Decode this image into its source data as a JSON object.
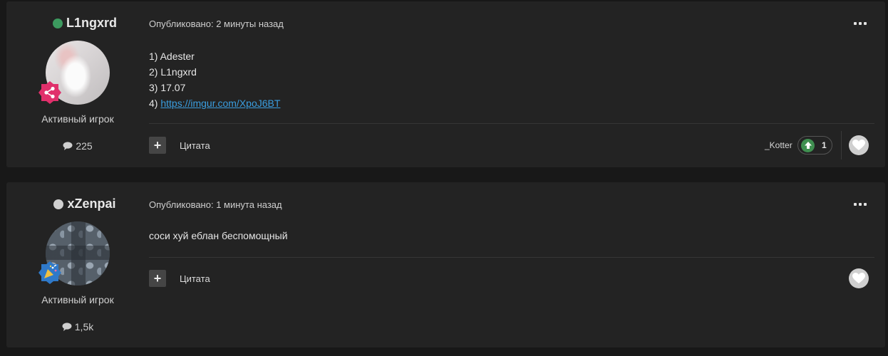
{
  "posts": [
    {
      "author": "L1ngxrd",
      "status_color": "#3c9a5f",
      "badge_color": "#e0306b",
      "badge_icon": "share-icon",
      "rank": "Активный игрок",
      "post_count": "225",
      "published": "Опубликовано: 2 минуты назад",
      "content_lines": [
        "1) Adester",
        "2) L1ngxrd",
        "3) 17.07"
      ],
      "content_link_prefix": "4) ",
      "content_link": "https://imgur.com/XpoJ6BT",
      "quote_label": "Цитата",
      "reaction": {
        "user": "_Kotter",
        "count": "1",
        "icon": "upvote-icon",
        "color": "#3f8f50"
      }
    },
    {
      "author": "xZenpai",
      "status_color": "#d0d0d0",
      "badge_color": "#2f79c9",
      "badge_icon": "party-popper-icon",
      "rank": "Активный игрок",
      "post_count": "1,5k",
      "published": "Опубликовано: 1 минута назад",
      "content": "соси хуй еблан беспомощный",
      "quote_label": "Цитата"
    }
  ]
}
